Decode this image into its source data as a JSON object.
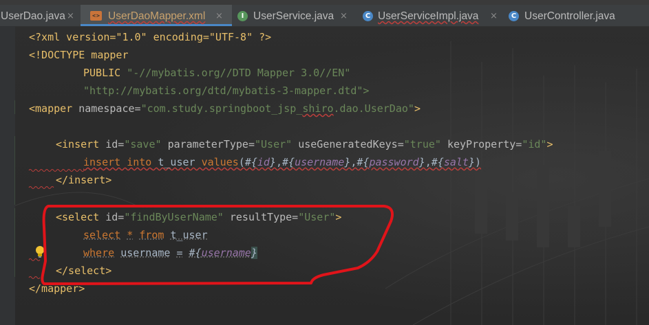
{
  "tabs": [
    {
      "label": "UserDao.java",
      "icon": "java-icon"
    },
    {
      "label": "UserDaoMapper.xml",
      "icon": "xml-icon",
      "active": true
    },
    {
      "label": "UserService.java",
      "icon": "interface-icon"
    },
    {
      "label": "UserServiceImpl.java",
      "icon": "class-icon"
    },
    {
      "label": "UserController.java",
      "icon": "class-icon"
    }
  ],
  "close_glyph": "×",
  "icon_letters": {
    "interface": "I",
    "class": "C",
    "xml": "<>"
  },
  "code": {
    "l1": {
      "text": "<?xml version=\"1.0\" encoding=\"UTF-8\" ?>"
    },
    "l2": {
      "text": "<!DOCTYPE mapper"
    },
    "l3": {
      "kw": "PUBLIC",
      "val": "\"-//mybatis.org//DTD Mapper 3.0//EN\""
    },
    "l4": {
      "val": "\"http://mybatis.org/dtd/mybatis-3-mapper.dtd\">"
    },
    "l5": {
      "open": "<mapper",
      "attr": "namespace=",
      "val_a": "\"com.study.springboot_jsp_",
      "val_b": "shiro",
      "val_c": ".dao.UserDao\"",
      "close": ">"
    },
    "l7": {
      "open": "<insert",
      "a1": "id=",
      "v1": "\"save\"",
      "a2": "parameterType=",
      "v2": "\"User\"",
      "a3": "useGeneratedKeys=",
      "v3": "\"true\"",
      "a4": "keyProperty=",
      "v4": "\"id\"",
      "close": ">"
    },
    "l8": {
      "k1": "insert",
      "k2": "into",
      "tbl": "t_user",
      "k3": "values",
      "p0": "(",
      "h1": "#{",
      "v1": "id",
      "e1": "}",
      "c1": ",",
      "h2": "#{",
      "v2": "username",
      "e2": "}",
      "c2": ",",
      "h3": "#{",
      "v3": "password",
      "e3": "}",
      "c3": ",",
      "h4": "#{",
      "v4": "salt",
      "e4": "}",
      "p1": ")"
    },
    "l9": {
      "text": "</insert>"
    },
    "l11": {
      "open": "<select",
      "a1": "id=",
      "v1": "\"findByUserName\"",
      "a2": "resultType=",
      "v2": "\"User\"",
      "close": ">"
    },
    "l12": {
      "k1": "select",
      "star": "*",
      "k2": "from",
      "tbl": "t_user"
    },
    "l13": {
      "k1": "where",
      "col": "username",
      "eq": "=",
      "h": "#{",
      "v": "username",
      "e": "}"
    },
    "l14": {
      "text": "</select>"
    },
    "l15": {
      "text": "</mapper>"
    }
  },
  "colors": {
    "annotation": "#e0141a",
    "tag": "#e8bf6a",
    "string": "#6a8759",
    "keyword": "#cc7832",
    "param": "#9876aa"
  }
}
